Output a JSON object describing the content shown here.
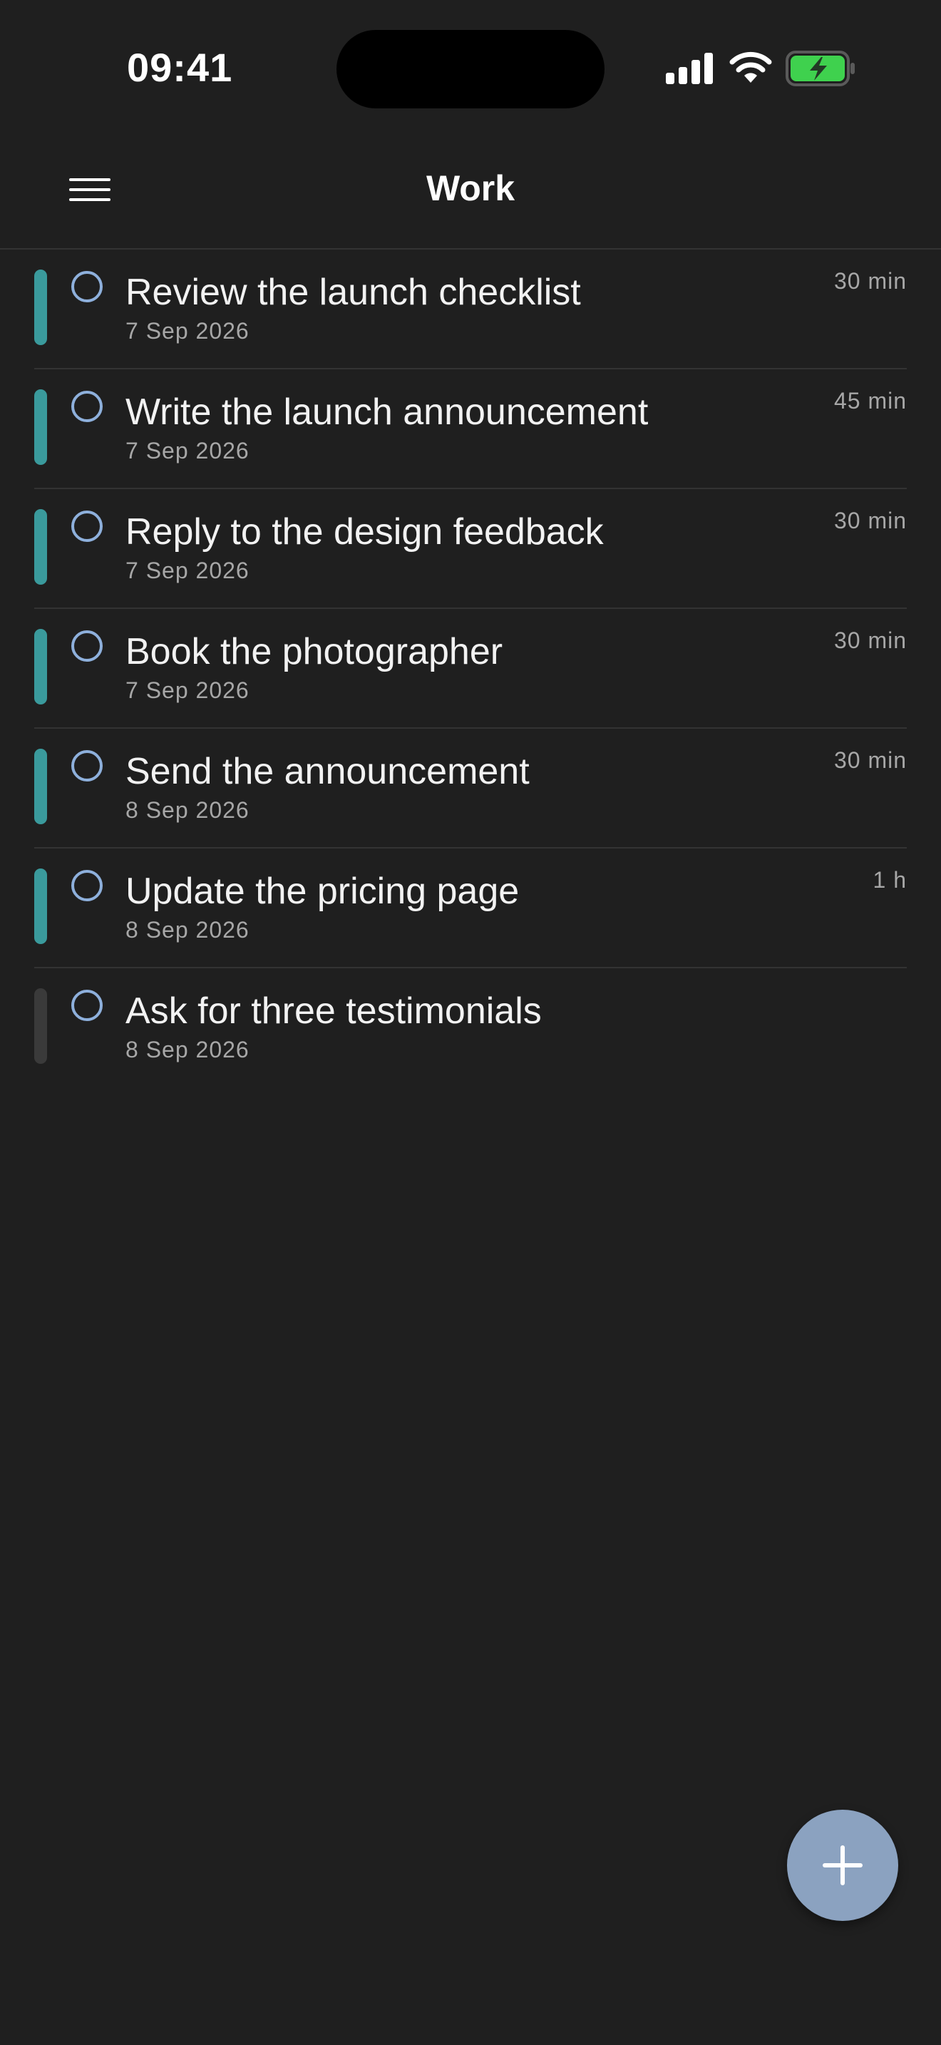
{
  "status_bar": {
    "time": "09:41"
  },
  "header": {
    "title": "Work",
    "menu_icon": "hamburger-menu-icon"
  },
  "colors": {
    "background": "#1f1f1f",
    "priority_teal": "#3a9a9c",
    "priority_none": "#3a3a3a",
    "checkbox_ring": "#8eb0dc",
    "fab": "#8ba2c0",
    "battery_fill": "#3fd14e"
  },
  "tasks": [
    {
      "title": "Review the launch checklist",
      "date": "7 Sep 2026",
      "duration": "30 min",
      "priority": "teal"
    },
    {
      "title": "Write the launch announcement",
      "date": "7 Sep 2026",
      "duration": "45 min",
      "priority": "teal"
    },
    {
      "title": "Reply to the design feedback",
      "date": "7 Sep 2026",
      "duration": "30 min",
      "priority": "teal"
    },
    {
      "title": "Book the photographer",
      "date": "7 Sep 2026",
      "duration": "30 min",
      "priority": "teal"
    },
    {
      "title": "Send the announcement",
      "date": "8 Sep 2026",
      "duration": "30 min",
      "priority": "teal"
    },
    {
      "title": "Update the pricing page",
      "date": "8 Sep 2026",
      "duration": "1 h",
      "priority": "teal"
    },
    {
      "title": "Ask for three testimonials",
      "date": "8 Sep 2026",
      "duration": "",
      "priority": "none"
    }
  ],
  "fab": {
    "icon": "plus-icon"
  }
}
